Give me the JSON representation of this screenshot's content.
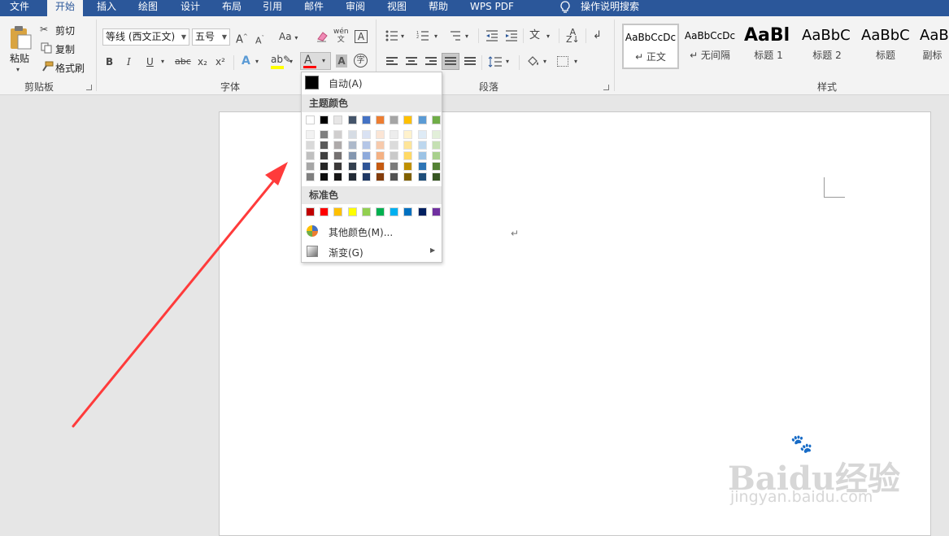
{
  "tabs": [
    {
      "label": "文件"
    },
    {
      "label": "开始"
    },
    {
      "label": "插入"
    },
    {
      "label": "绘图"
    },
    {
      "label": "设计"
    },
    {
      "label": "布局"
    },
    {
      "label": "引用"
    },
    {
      "label": "邮件"
    },
    {
      "label": "审阅"
    },
    {
      "label": "视图"
    },
    {
      "label": "帮助"
    },
    {
      "label": "WPS PDF"
    }
  ],
  "tell_me": "操作说明搜索",
  "clipboard": {
    "paste": "粘贴",
    "cut": "剪切",
    "copy": "复制",
    "format_painter": "格式刷",
    "group": "剪贴板"
  },
  "font": {
    "name": "等线 (西文正文)",
    "size": "五号",
    "grow": "A",
    "shrink": "A",
    "case": "Aa",
    "phonetic": "wén",
    "bold": "B",
    "italic": "I",
    "underline": "U",
    "strike": "abc",
    "sub": "x₂",
    "sup": "x²",
    "effects": "A",
    "font_color": "A",
    "shading": "A",
    "enclose": "字",
    "group": "字体"
  },
  "paragraph": {
    "group": "段落"
  },
  "styles": {
    "group": "样式",
    "items": [
      {
        "preview": "AaBbCcDc",
        "name": "↵ 正文"
      },
      {
        "preview": "AaBbCcDc",
        "name": "↵ 无间隔"
      },
      {
        "preview": "AaBl",
        "name": "标题 1"
      },
      {
        "preview": "AaBbC",
        "name": "标题 2"
      },
      {
        "preview": "AaBbC",
        "name": "标题"
      },
      {
        "preview": "AaB",
        "name": "副标"
      }
    ]
  },
  "color_menu": {
    "auto": "自动(A)",
    "theme_label": "主题颜色",
    "standard_label": "标准色",
    "more": "其他颜色(M)...",
    "gradient": "渐变(G)",
    "theme_top": [
      "#ffffff",
      "#000000",
      "#e7e6e6",
      "#44546a",
      "#4472c4",
      "#ed7d31",
      "#a5a5a5",
      "#ffc000",
      "#5b9bd5",
      "#70ad47"
    ],
    "theme_shades": [
      [
        "#f2f2f2",
        "#d9d9d9",
        "#bfbfbf",
        "#a6a6a6",
        "#7f7f7f"
      ],
      [
        "#7f7f7f",
        "#595959",
        "#404040",
        "#262626",
        "#0d0d0d"
      ],
      [
        "#d0cece",
        "#aeaaaa",
        "#757171",
        "#3a3838",
        "#171616"
      ],
      [
        "#d6dce4",
        "#adb9ca",
        "#8497b0",
        "#333f4f",
        "#222a35"
      ],
      [
        "#d9e2f3",
        "#b4c6e7",
        "#8eaadb",
        "#2f5496",
        "#1f3864"
      ],
      [
        "#fbe5d5",
        "#f7caac",
        "#f4b183",
        "#c55a11",
        "#833c0b"
      ],
      [
        "#ededed",
        "#dbdbdb",
        "#c9c9c9",
        "#7b7b7b",
        "#525252"
      ],
      [
        "#fff2cc",
        "#fee599",
        "#ffd965",
        "#bf9000",
        "#7f6000"
      ],
      [
        "#deebf6",
        "#bdd7ee",
        "#9cc3e5",
        "#2e75b5",
        "#1f4e79"
      ],
      [
        "#e2efd9",
        "#c5e0b3",
        "#a8d08d",
        "#538135",
        "#375623"
      ]
    ],
    "standard": [
      "#c00000",
      "#ff0000",
      "#ffc000",
      "#ffff00",
      "#92d050",
      "#00b050",
      "#00b0f0",
      "#0070c0",
      "#002060",
      "#7030a0"
    ]
  },
  "document": {
    "para_mark": "↵"
  },
  "watermark": {
    "brand": "Baidu经验",
    "url": "jingyan.baidu.com"
  },
  "colors": {
    "accent": "#2b579a",
    "font_color_bar": "#ff0000",
    "highlight_bar": "#ffff00",
    "arrow": "#ff3b3b"
  }
}
